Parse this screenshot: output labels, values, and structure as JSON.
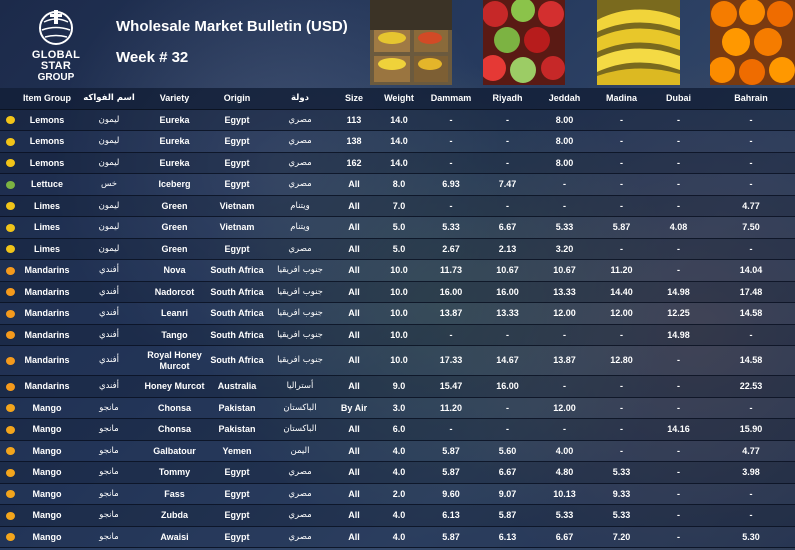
{
  "header": {
    "logo_line1": "GLOBAL STAR",
    "logo_line2": "GROUP",
    "title": "Wholesale Market Bulletin (USD)",
    "week": "Week # 32"
  },
  "colors": {
    "lemon": "#f2c418",
    "lettuce": "#7cb342",
    "lime": "#f0c419",
    "mandarin": "#f59a1c",
    "mango": "#f3a51c"
  },
  "table": {
    "columns": [
      "Item Group",
      "اسم الفواكه",
      "Variety",
      "Origin",
      "دولة",
      "Size",
      "Weight",
      "Dammam",
      "Riyadh",
      "Jeddah",
      "Madina",
      "Dubai",
      "Bahrain"
    ],
    "rows": [
      {
        "icon": "lemon-icon",
        "color": "#f2c418",
        "cells": [
          "Lemons",
          "ليمون",
          "Eureka",
          "Egypt",
          "مصري",
          "113",
          "14.0",
          "-",
          "-",
          "8.00",
          "-",
          "-",
          "-"
        ]
      },
      {
        "icon": "lemon-icon",
        "color": "#f2c418",
        "cells": [
          "Lemons",
          "ليمون",
          "Eureka",
          "Egypt",
          "مصري",
          "138",
          "14.0",
          "-",
          "-",
          "8.00",
          "-",
          "-",
          "-"
        ]
      },
      {
        "icon": "lemon-icon",
        "color": "#f2c418",
        "cells": [
          "Lemons",
          "ليمون",
          "Eureka",
          "Egypt",
          "مصري",
          "162",
          "14.0",
          "-",
          "-",
          "8.00",
          "-",
          "-",
          "-"
        ]
      },
      {
        "icon": "lettuce-icon",
        "color": "#7cb342",
        "cells": [
          "Lettuce",
          "خس",
          "Iceberg",
          "Egypt",
          "مصري",
          "All",
          "8.0",
          "6.93",
          "7.47",
          "-",
          "-",
          "-",
          "-"
        ]
      },
      {
        "icon": "lime-icon",
        "color": "#f0c419",
        "cells": [
          "Limes",
          "ليمون",
          "Green",
          "Vietnam",
          "ويتنام",
          "All",
          "7.0",
          "-",
          "-",
          "-",
          "-",
          "-",
          "4.77"
        ]
      },
      {
        "icon": "lime-icon",
        "color": "#f0c419",
        "cells": [
          "Limes",
          "ليمون",
          "Green",
          "Vietnam",
          "ويتنام",
          "All",
          "5.0",
          "5.33",
          "6.67",
          "5.33",
          "5.87",
          "4.08",
          "7.50"
        ]
      },
      {
        "icon": "lime-icon",
        "color": "#f0c419",
        "cells": [
          "Limes",
          "ليمون",
          "Green",
          "Egypt",
          "مصري",
          "All",
          "5.0",
          "2.67",
          "2.13",
          "3.20",
          "-",
          "-",
          "-"
        ]
      },
      {
        "icon": "mandarin-icon",
        "color": "#f59a1c",
        "cells": [
          "Mandarins",
          "أفندي",
          "Nova",
          "South Africa",
          "جنوب افريقيا",
          "All",
          "10.0",
          "11.73",
          "10.67",
          "10.67",
          "11.20",
          "-",
          "14.04"
        ]
      },
      {
        "icon": "mandarin-icon",
        "color": "#f59a1c",
        "cells": [
          "Mandarins",
          "أفندي",
          "Nadorcot",
          "South Africa",
          "جنوب افريقيا",
          "All",
          "10.0",
          "16.00",
          "16.00",
          "13.33",
          "14.40",
          "14.98",
          "17.48"
        ]
      },
      {
        "icon": "mandarin-icon",
        "color": "#f59a1c",
        "cells": [
          "Mandarins",
          "أفندي",
          "Leanri",
          "South Africa",
          "جنوب افريقيا",
          "All",
          "10.0",
          "13.87",
          "13.33",
          "12.00",
          "12.00",
          "12.25",
          "14.58"
        ]
      },
      {
        "icon": "mandarin-icon",
        "color": "#f59a1c",
        "cells": [
          "Mandarins",
          "أفندي",
          "Tango",
          "South Africa",
          "جنوب افريقيا",
          "All",
          "10.0",
          "-",
          "-",
          "-",
          "-",
          "14.98",
          "-"
        ]
      },
      {
        "icon": "mandarin-icon",
        "color": "#f59a1c",
        "tall": true,
        "cells": [
          "Mandarins",
          "أفندي",
          "Royal Honey Murcot",
          "South Africa",
          "جنوب افريقيا",
          "All",
          "10.0",
          "17.33",
          "14.67",
          "13.87",
          "12.80",
          "-",
          "14.58"
        ]
      },
      {
        "icon": "mandarin-icon",
        "color": "#f59a1c",
        "cells": [
          "Mandarins",
          "أفندي",
          "Honey Murcot",
          "Australia",
          "أستراليا",
          "All",
          "9.0",
          "15.47",
          "16.00",
          "-",
          "-",
          "-",
          "22.53"
        ]
      },
      {
        "icon": "mango-icon",
        "color": "#f3a51c",
        "cells": [
          "Mango",
          "مانجو",
          "Chonsa",
          "Pakistan",
          "الباكستان",
          "By Air",
          "3.0",
          "11.20",
          "-",
          "12.00",
          "-",
          "-",
          "-"
        ]
      },
      {
        "icon": "mango-icon",
        "color": "#f3a51c",
        "cells": [
          "Mango",
          "مانجو",
          "Chonsa",
          "Pakistan",
          "الباكستان",
          "All",
          "6.0",
          "-",
          "-",
          "-",
          "-",
          "14.16",
          "15.90"
        ]
      },
      {
        "icon": "mango-icon",
        "color": "#f3a51c",
        "cells": [
          "Mango",
          "مانجو",
          "Galbatour",
          "Yemen",
          "اليمن",
          "All",
          "4.0",
          "5.87",
          "5.60",
          "4.00",
          "-",
          "-",
          "4.77"
        ]
      },
      {
        "icon": "mango-icon",
        "color": "#f3a51c",
        "cells": [
          "Mango",
          "مانجو",
          "Tommy",
          "Egypt",
          "مصري",
          "All",
          "4.0",
          "5.87",
          "6.67",
          "4.80",
          "5.33",
          "-",
          "3.98"
        ]
      },
      {
        "icon": "mango-icon",
        "color": "#f3a51c",
        "cells": [
          "Mango",
          "مانجو",
          "Fass",
          "Egypt",
          "مصري",
          "All",
          "2.0",
          "9.60",
          "9.07",
          "10.13",
          "9.33",
          "-",
          "-"
        ]
      },
      {
        "icon": "mango-icon",
        "color": "#f3a51c",
        "cells": [
          "Mango",
          "مانجو",
          "Zubda",
          "Egypt",
          "مصري",
          "All",
          "4.0",
          "6.13",
          "5.87",
          "5.33",
          "5.33",
          "-",
          "-"
        ]
      },
      {
        "icon": "mango-icon",
        "color": "#f3a51c",
        "cells": [
          "Mango",
          "مانجو",
          "Awaisi",
          "Egypt",
          "مصري",
          "All",
          "4.0",
          "5.87",
          "6.13",
          "6.67",
          "7.20",
          "-",
          "5.30"
        ]
      }
    ]
  }
}
